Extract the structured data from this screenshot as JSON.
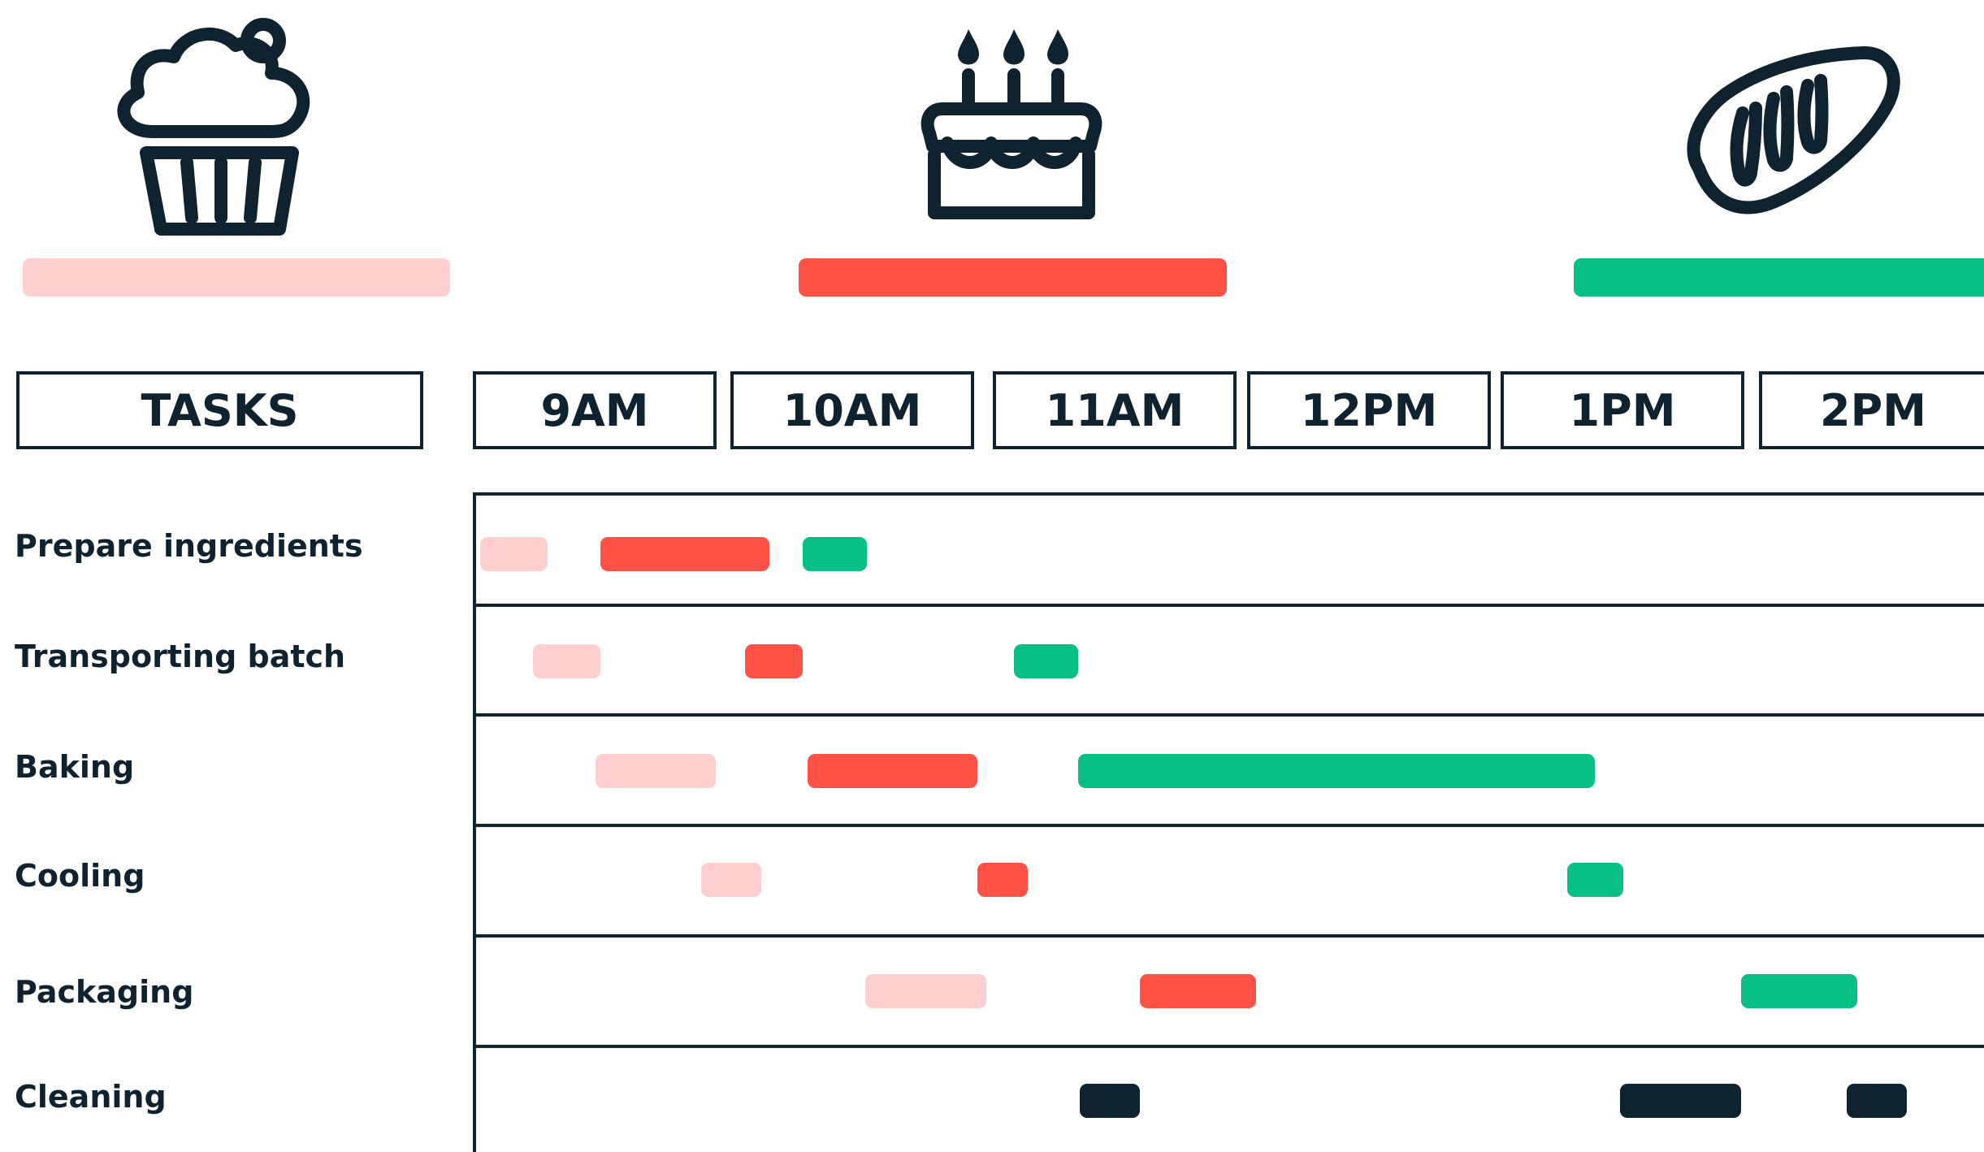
{
  "colors": {
    "cupcake": "#ffcfcf",
    "cake": "#ff5247",
    "bread": "#08bf86",
    "cleaning": "#0f2230",
    "ink": "#0f2230"
  },
  "legend": [
    {
      "icon": "cupcake-icon",
      "color": "#ffcfcf"
    },
    {
      "icon": "birthday-cake-icon",
      "color": "#ff5247"
    },
    {
      "icon": "bread-loaf-icon",
      "color": "#08bf86"
    }
  ],
  "header": {
    "tasks_label": "TASKS",
    "times": [
      "9AM",
      "10AM",
      "11AM",
      "12PM",
      "1PM",
      "2PM"
    ]
  },
  "tasks": [
    {
      "label": "Prepare ingredients"
    },
    {
      "label": "Transporting batch"
    },
    {
      "label": "Baking"
    },
    {
      "label": "Cooling"
    },
    {
      "label": "Packaging"
    },
    {
      "label": "Cleaning"
    }
  ],
  "schedule": [
    {
      "task": "Prepare ingredients",
      "product": "cupcake",
      "start": "9:00",
      "end": "9:17"
    },
    {
      "task": "Prepare ingredients",
      "product": "cake",
      "start": "9:30",
      "end": "10:12"
    },
    {
      "task": "Prepare ingredients",
      "product": "bread",
      "start": "10:20",
      "end": "10:36"
    },
    {
      "task": "Transporting batch",
      "product": "cupcake",
      "start": "9:14",
      "end": "9:31"
    },
    {
      "task": "Transporting batch",
      "product": "cake",
      "start": "10:06",
      "end": "10:20"
    },
    {
      "task": "Transporting batch",
      "product": "bread",
      "start": "11:08",
      "end": "11:24"
    },
    {
      "task": "Baking",
      "product": "cupcake",
      "start": "9:29",
      "end": "9:59"
    },
    {
      "task": "Baking",
      "product": "cake",
      "start": "10:21",
      "end": "11:03"
    },
    {
      "task": "Baking",
      "product": "bread",
      "start": "11:24",
      "end": "1:32"
    },
    {
      "task": "Cooling",
      "product": "cupcake",
      "start": "9:55",
      "end": "10:10"
    },
    {
      "task": "Cooling",
      "product": "cake",
      "start": "11:03",
      "end": "11:15"
    },
    {
      "task": "Cooling",
      "product": "bread",
      "start": "1:28",
      "end": "1:42"
    },
    {
      "task": "Packaging",
      "product": "cupcake",
      "start": "10:36",
      "end": "11:06"
    },
    {
      "task": "Packaging",
      "product": "cake",
      "start": "11:44",
      "end": "12:13"
    },
    {
      "task": "Packaging",
      "product": "bread",
      "start": "2:11",
      "end": "2:40"
    },
    {
      "task": "Cleaning",
      "product": "cleaning",
      "start": "11:24",
      "end": "11:39"
    },
    {
      "task": "Cleaning",
      "product": "cleaning",
      "start": "1:41",
      "end": "2:11"
    },
    {
      "task": "Cleaning",
      "product": "cleaning",
      "start": "2:37",
      "end": "2:52"
    }
  ]
}
